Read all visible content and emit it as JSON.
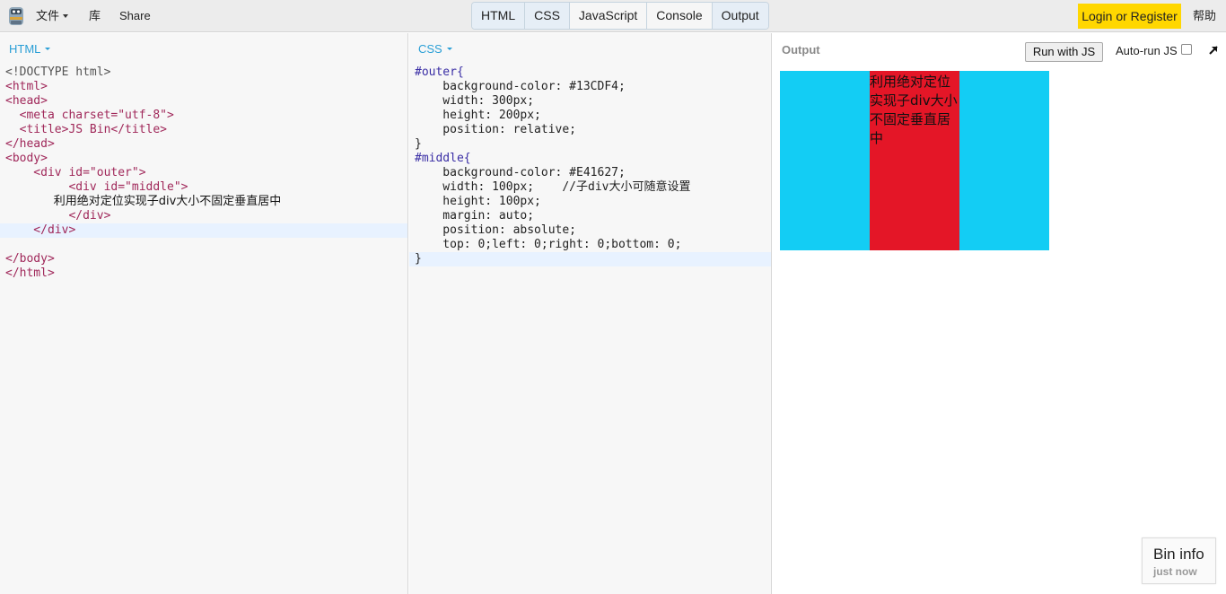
{
  "toolbar": {
    "logo_icon": "jsbin-robot-icon",
    "file_menu": "文件",
    "library": "库",
    "share": "Share",
    "panels": [
      "HTML",
      "CSS",
      "JavaScript",
      "Console",
      "Output"
    ],
    "login": "Login or Register",
    "help": "帮助",
    "login_color": "#FFD700"
  },
  "html_panel": {
    "label": "HTML",
    "lines": [
      "<!DOCTYPE html>",
      "<html>",
      "<head>",
      "  <meta charset=\"utf-8\">",
      "  <title>JS Bin</title>",
      "</head>",
      "<body>",
      "    <div id=\"outer\">",
      "         <div id=\"middle\">",
      "             利用绝对定位实现子div大小不固定垂直居中",
      "         </div>",
      "    </div>",
      "",
      "</body>",
      "</html>"
    ]
  },
  "css_panel": {
    "label": "CSS",
    "lines": [
      "#outer{",
      "    background-color: #13CDF4;",
      "    width: 300px;",
      "    height: 200px;",
      "    position: relative;",
      "}",
      "#middle{",
      "    background-color: #E41627;",
      "    width: 100px;    //子div大小可随意设置",
      "    height: 100px;",
      "    margin: auto;",
      "    position: absolute;",
      "    top: 0;left: 0;right: 0;bottom: 0;",
      "}"
    ]
  },
  "output_panel": {
    "label": "Output",
    "run_button": "Run with JS",
    "autorun_label": "Auto-run JS",
    "autorun_checked": false,
    "popout_icon": "popout-arrow-icon",
    "preview_text": "利用绝对定位实现子div大小不固定垂直居中",
    "outer_color": "#13CDF4",
    "middle_color": "#E41627"
  },
  "bin_info": {
    "title": "Bin info",
    "subtitle": "just now"
  }
}
